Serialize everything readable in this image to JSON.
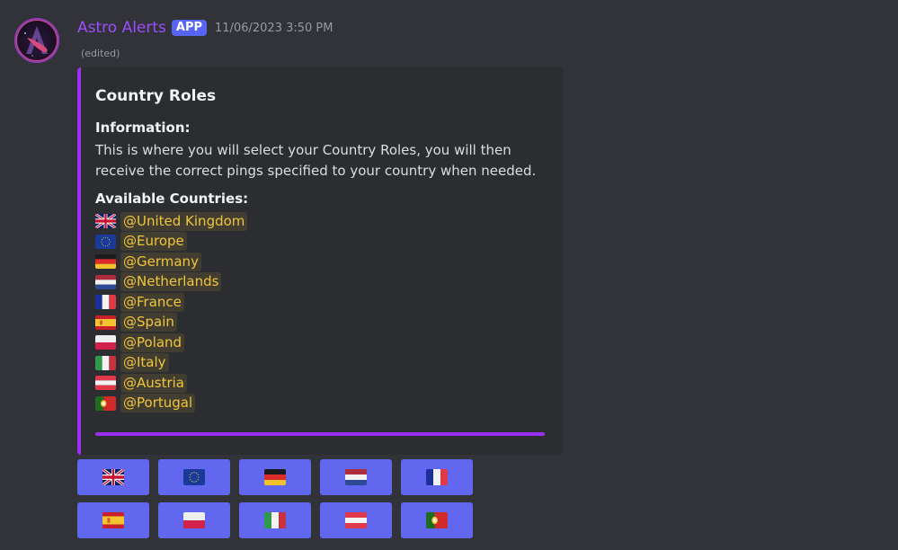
{
  "message": {
    "author": "Astro Alerts",
    "badge": "APP",
    "timestamp": "11/06/2023 3:50 PM",
    "edited_label": "(edited)",
    "colors": {
      "author": "#9b4dff",
      "embed_accent": "#9b2ff5",
      "button": "#6168ef",
      "mention_text": "#f0c53a"
    }
  },
  "embed": {
    "title": "Country Roles",
    "fields": [
      {
        "name": "Information:",
        "value": "This is where you will select your Country Roles, you will then receive the correct pings specified to your country when needed."
      },
      {
        "name": "Available Countries:"
      }
    ],
    "countries": [
      {
        "flag": "gb-flag",
        "mention": "@United Kingdom"
      },
      {
        "flag": "eu-flag",
        "mention": "@Europe"
      },
      {
        "flag": "de-flag",
        "mention": "@Germany"
      },
      {
        "flag": "nl-flag",
        "mention": "@Netherlands"
      },
      {
        "flag": "fr-flag",
        "mention": "@France"
      },
      {
        "flag": "es-flag",
        "mention": "@Spain"
      },
      {
        "flag": "pl-flag",
        "mention": "@Poland"
      },
      {
        "flag": "it-flag",
        "mention": "@Italy"
      },
      {
        "flag": "at-flag",
        "mention": "@Austria"
      },
      {
        "flag": "pt-flag",
        "mention": "@Portugal"
      }
    ]
  },
  "buttons": [
    {
      "flag": "gb-flag",
      "country": "United Kingdom"
    },
    {
      "flag": "eu-flag",
      "country": "Europe"
    },
    {
      "flag": "de-flag",
      "country": "Germany"
    },
    {
      "flag": "nl-flag",
      "country": "Netherlands"
    },
    {
      "flag": "fr-flag",
      "country": "France"
    },
    {
      "flag": "es-flag",
      "country": "Spain"
    },
    {
      "flag": "pl-flag",
      "country": "Poland"
    },
    {
      "flag": "it-flag",
      "country": "Italy"
    },
    {
      "flag": "at-flag",
      "country": "Austria"
    },
    {
      "flag": "pt-flag",
      "country": "Portugal"
    }
  ]
}
